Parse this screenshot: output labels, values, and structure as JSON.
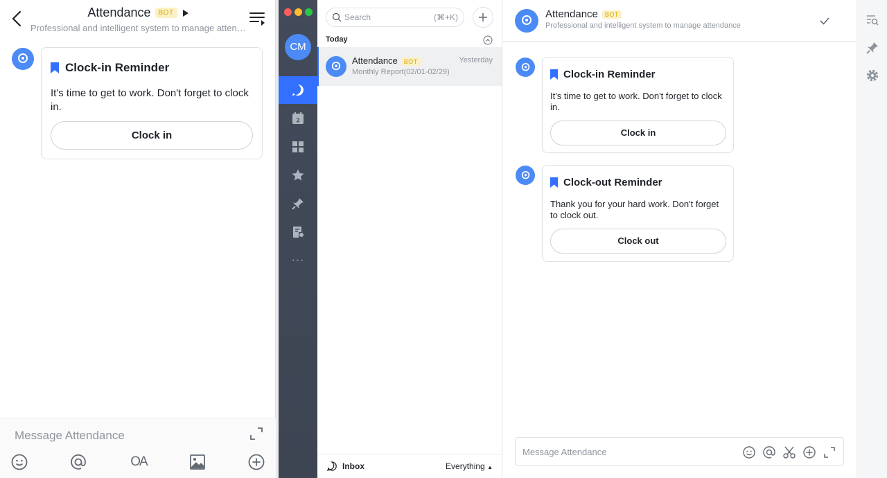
{
  "mobile": {
    "title": "Attendance",
    "bot_tag": "BOT",
    "subtitle": "Professional and intelligent system to manage attendance",
    "card": {
      "title": "Clock-in Reminder",
      "body": "It's time to get to work. Don't forget to clock in.",
      "button": "Clock in"
    },
    "input_placeholder": "Message Attendance",
    "tools": [
      "emoji-icon",
      "at-icon",
      "oa-icon",
      "image-icon",
      "plus-icon"
    ],
    "oa_label": "OA"
  },
  "rail": {
    "avatar_initials": "CM",
    "calendar_day": "2",
    "more": "···",
    "items": [
      "chat-icon",
      "calendar-icon",
      "apps-icon",
      "star-icon",
      "pin-icon",
      "docs-icon",
      "more-icon"
    ]
  },
  "list": {
    "search_placeholder": "Search",
    "search_shortcut": "(⌘+K)",
    "section": "Today",
    "chat": {
      "name": "Attendance",
      "bot_tag": "BOT",
      "time": "Yesterday",
      "preview": "Monthly Report(02/01-02/29)"
    },
    "footer": {
      "inbox": "Inbox",
      "filter": "Everything"
    }
  },
  "chat": {
    "title": "Attendance",
    "bot_tag": "BOT",
    "subtitle": "Professional and intelligent system to manage attendance",
    "input_placeholder": "Message Attendance",
    "messages": [
      {
        "title": "Clock-in Reminder",
        "body": "It's time to get to work. Don't forget to clock in.",
        "button": "Clock in"
      },
      {
        "title": "Clock-out Reminder",
        "body": "Thank you for your hard work. Don't forget to clock out.",
        "button": "Clock out"
      }
    ]
  },
  "colors": {
    "accent": "#3370ff",
    "avatar": "#4c8bf5",
    "bot_tag_bg": "#fcf0c5",
    "bot_tag_text": "#d9a800",
    "rail": "#434b5a"
  }
}
